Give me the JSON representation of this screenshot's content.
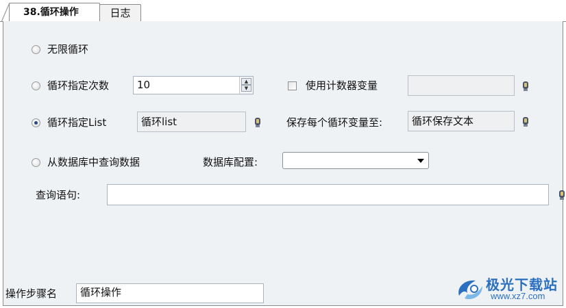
{
  "tabs": [
    {
      "label": "38.循环操作",
      "active": true
    },
    {
      "label": "日志",
      "active": false
    }
  ],
  "loop_options": {
    "infinite_label": "无限循环",
    "count_label": "循环指定次数",
    "count_value": "10",
    "list_label": "循环指定List",
    "list_value": "循环list",
    "db_label": "从数据库中查询数据",
    "selected": "list"
  },
  "counter_var": {
    "label": "使用计数器变量",
    "checked": false,
    "value": ""
  },
  "save_var": {
    "label": "保存每个循环变量至:",
    "value": "循环保存文本"
  },
  "db_config": {
    "label": "数据库配置:",
    "value": ""
  },
  "query": {
    "label": "查询语句:",
    "value": ""
  },
  "step": {
    "label": "操作步骤名",
    "value": "循环操作"
  },
  "watermark": {
    "title": "极光下载站",
    "url": "www.xz7.com"
  },
  "colors": {
    "accent": "#2a6fc0",
    "panel_bg": "#eff2f5",
    "border": "#8a8a8a"
  },
  "icons": [
    "variable-picker-icon",
    "spin-up-icon",
    "spin-down-icon",
    "chevron-down-icon",
    "watermark-logo-icon"
  ]
}
